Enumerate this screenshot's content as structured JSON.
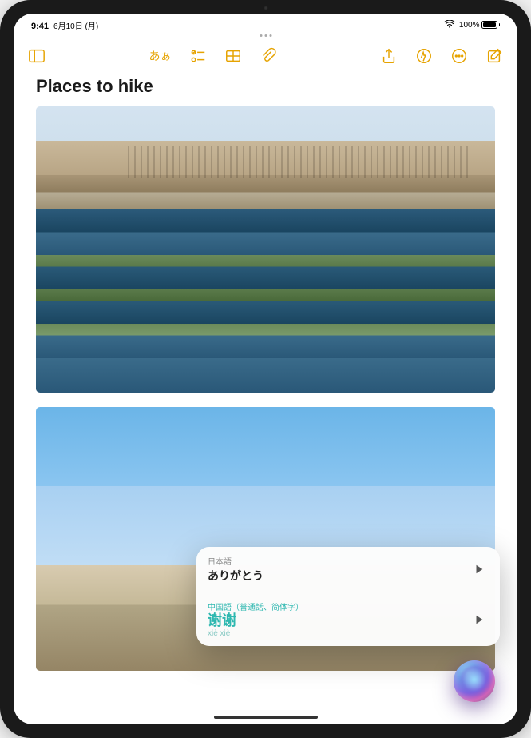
{
  "status_bar": {
    "time": "9:41",
    "date": "6月10日 (月)",
    "battery_text": "100%"
  },
  "toolbar": {
    "format_label": "あぁ"
  },
  "note": {
    "title": "Places to hike"
  },
  "siri": {
    "source": {
      "lang_label": "日本語",
      "phrase": "ありがとう"
    },
    "target": {
      "lang_label": "中国語（普通話、简体字）",
      "phrase": "谢谢",
      "romanization": "xiè xiè"
    }
  }
}
